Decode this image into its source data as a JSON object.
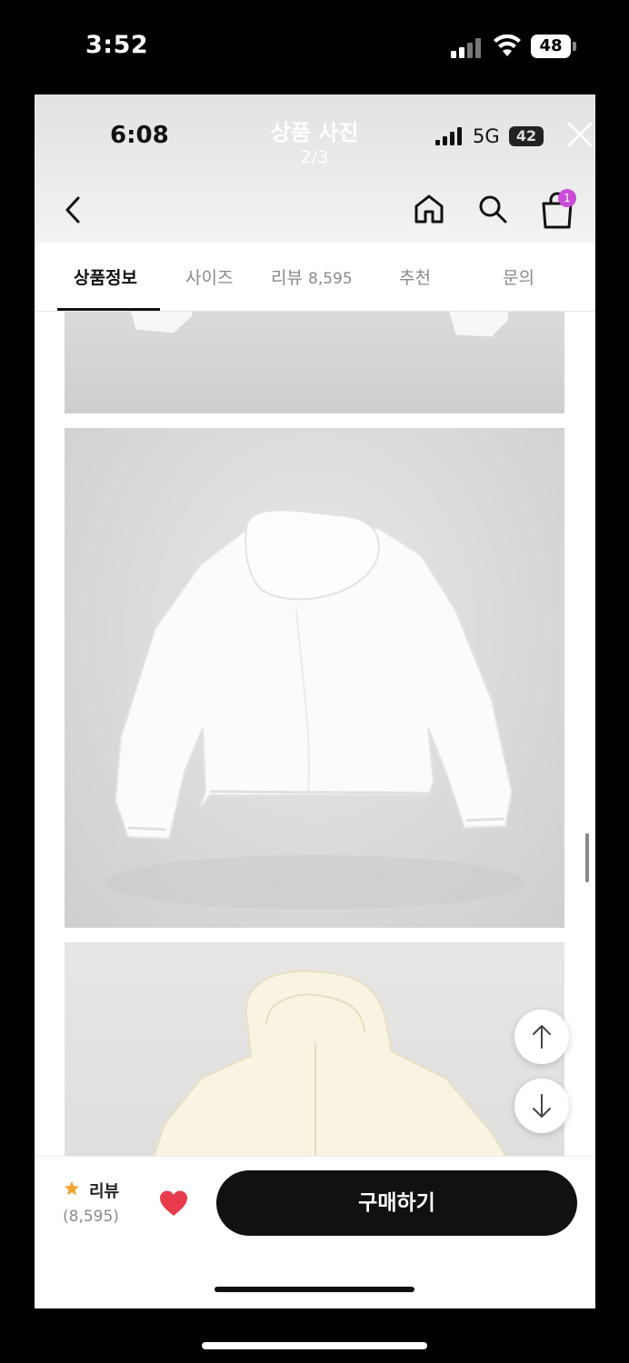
{
  "outer_status": {
    "time": "3:52",
    "battery": "48"
  },
  "inner_status": {
    "time": "6:08",
    "network": "5G",
    "battery": "42"
  },
  "viewer": {
    "title": "상품 사진",
    "page": "2/3"
  },
  "header": {
    "cart_count": "1"
  },
  "tabs": [
    {
      "label": "상품정보",
      "active": true
    },
    {
      "label": "사이즈",
      "active": false
    },
    {
      "label": "리뷰",
      "count": "8,595",
      "active": false
    },
    {
      "label": "추천",
      "active": false
    },
    {
      "label": "문의",
      "active": false
    }
  ],
  "bottom": {
    "review_label": "리뷰",
    "review_count": "(8,595)",
    "buy_label": "구매하기"
  },
  "colors": {
    "accent": "#111111",
    "badge": "#c94cd8",
    "heart": "#e83b4b",
    "star": "#f2a531"
  },
  "icons": [
    "back-icon",
    "home-icon",
    "search-icon",
    "shopping-bag-icon",
    "close-icon",
    "arrow-up-icon",
    "arrow-down-icon",
    "star-icon",
    "heart-icon"
  ]
}
